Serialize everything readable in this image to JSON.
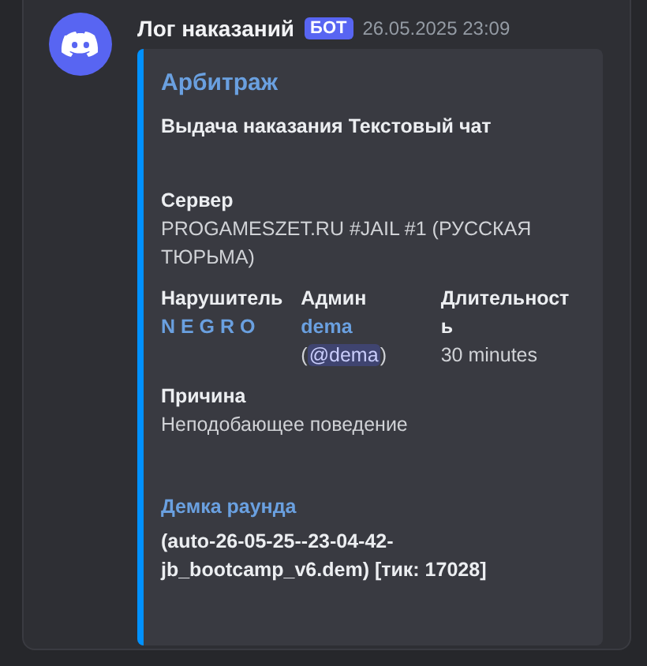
{
  "message": {
    "author": "Лог наказаний",
    "bot_tag": "БОТ",
    "timestamp": "26.05.2025 23:09",
    "embed": {
      "title": "Арбитраж",
      "description": "Выдача наказания Текстовый чат",
      "field_rows": [
        [
          {
            "kind": "plain",
            "name": "Сервер",
            "value": "PROGAMESZET.RU #JAIL #1 (РУССКАЯ ТЮРЬМА)"
          }
        ],
        [
          {
            "kind": "link",
            "name": "Нарушитель",
            "value": "N E G R O"
          },
          {
            "kind": "user",
            "name": "Админ",
            "value": "dema",
            "before": "(",
            "mention": "@dema",
            "after": ")"
          },
          {
            "kind": "plain",
            "name": "Длительность",
            "value": "30 minutes"
          }
        ],
        [
          {
            "kind": "plain",
            "name": "Причина",
            "value": "Неподобающее поведение"
          }
        ],
        [
          {
            "kind": "link_title",
            "name": "Демка раунда",
            "value": "(auto-26-05-25--23-04-42-jb_bootcamp_v6.dem) [тик: 17028]"
          }
        ]
      ]
    }
  }
}
